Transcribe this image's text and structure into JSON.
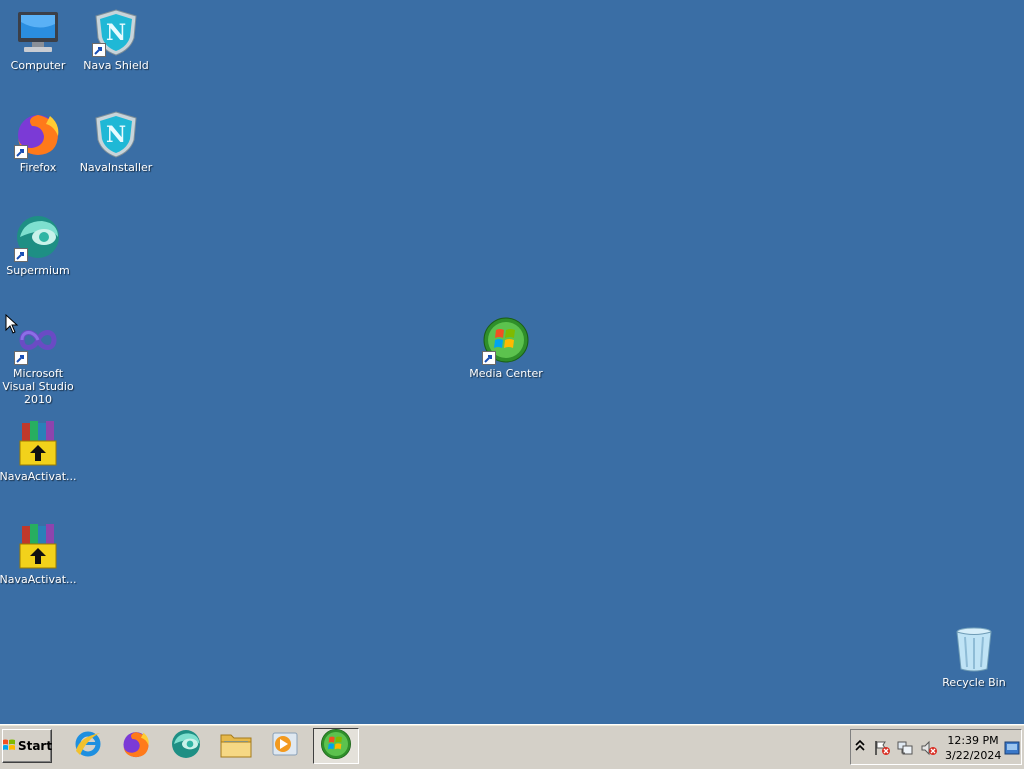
{
  "desktop": {
    "background": "#3a6ea5",
    "icons": {
      "computer": "Computer",
      "nava_shield": "Nava Shield",
      "firefox": "Firefox",
      "nava_installer": "NavaInstaller",
      "supermium": "Supermium",
      "visual_studio": "Microsoft Visual Studio 2010",
      "media_center": "Media Center",
      "nava_activator_1": "NavaActivat...",
      "nava_activator_2": "NavaActivat...",
      "recycle_bin": "Recycle Bin"
    }
  },
  "taskbar": {
    "start_label": "Start",
    "pinned": [
      "internet-explorer",
      "firefox",
      "supermium",
      "file-explorer",
      "media-player",
      "media-center"
    ],
    "tray": {
      "time": "12:39 PM",
      "date": "3/22/2024"
    }
  }
}
